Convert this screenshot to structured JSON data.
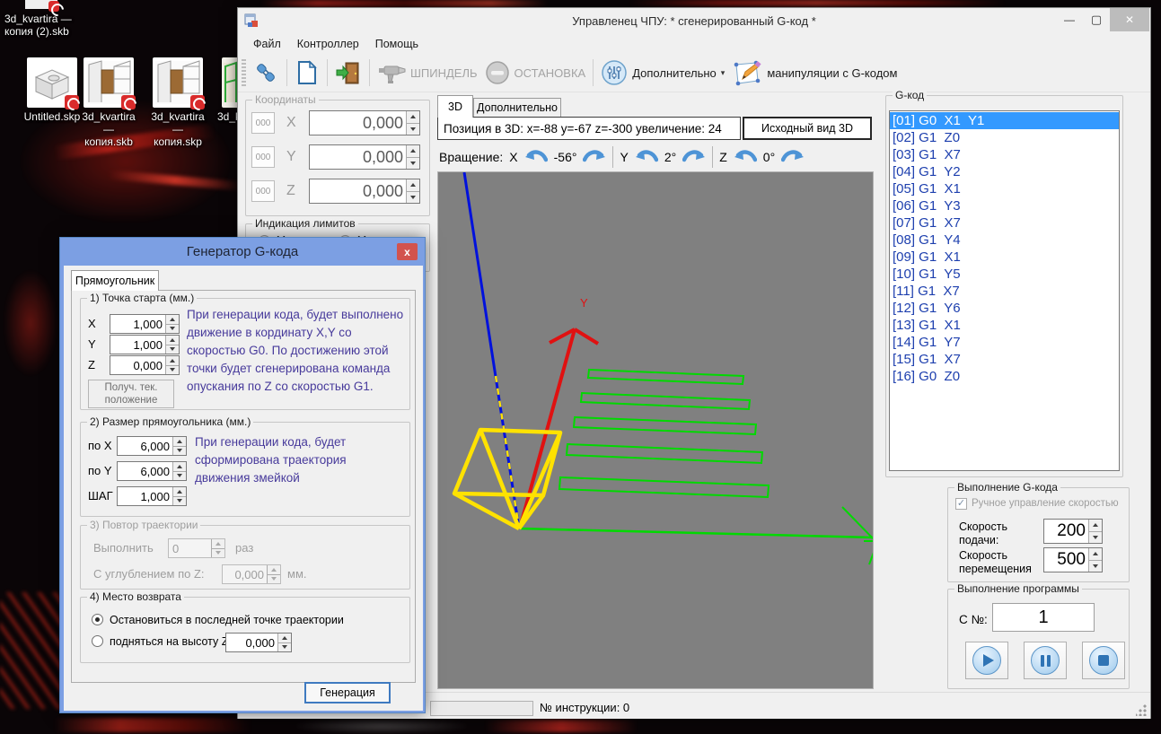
{
  "desktop": {
    "top_file_label": "3d_kvartira — копия (2).skb",
    "icons": [
      {
        "label": "Untitled.skp"
      },
      {
        "label": "3d_kvartira — копия.skb"
      },
      {
        "label": "3d_kvartira — копия.skp"
      },
      {
        "label": "3d_k"
      }
    ]
  },
  "window": {
    "title": "Управленец ЧПУ: * сгенерированный G-код *",
    "menu": {
      "file": "Файл",
      "controller": "Контроллер",
      "help": "Помощь"
    },
    "toolbar": {
      "spindle_label": "ШПИНДЕЛЬ",
      "stop_label": "ОСТАНОВКА",
      "extra_label": "Дополнительно",
      "manip_label": "манипуляции с G-кодом"
    }
  },
  "coords": {
    "title": "Координаты",
    "zero_btn": "000",
    "axis_x": "X",
    "axis_y": "Y",
    "axis_z": "Z",
    "x_value": "0,000",
    "y_value": "0,000",
    "z_value": "0,000"
  },
  "limits": {
    "title": "Индикация лимитов",
    "xmin_label": "Хмин",
    "xmax_label": "Хмакс"
  },
  "view3d": {
    "tab_3d": "3D",
    "tab_extra": "Дополнительно",
    "position_text": "Позиция в 3D: x=-88 y=-67 z=-300 увеличение: 24",
    "reset_button": "Исходный вид 3D",
    "rotation_label": "Вращение:",
    "rot": [
      {
        "axis": "X",
        "value": "-56°"
      },
      {
        "axis": "Y",
        "value": "2°"
      },
      {
        "axis": "Z",
        "value": "0°"
      }
    ],
    "axis_y_label": "Y"
  },
  "gcode": {
    "title": "G-код",
    "items": [
      "[01] G0  X1  Y1",
      "[02] G1  Z0",
      "[03] G1  X7",
      "[04] G1  Y2",
      "[05] G1  X1",
      "[06] G1  Y3",
      "[07] G1  X7",
      "[08] G1  Y4",
      "[09] G1  X1",
      "[10] G1  Y5",
      "[11] G1  X7",
      "[12] G1  Y6",
      "[13] G1  X1",
      "[14] G1  Y7",
      "[15] G1  X7",
      "[16] G0  Z0"
    ]
  },
  "exec": {
    "title": "Выполнение G-кода",
    "manual_label": "Ручное управление скоростью",
    "feed_label": "Скорость подачи:",
    "feed_value": "200",
    "move_label": "Скорость перемещения",
    "move_value": "500"
  },
  "program": {
    "title": "Выполнение программы",
    "from_label": "С №:",
    "from_value": "1"
  },
  "status": {
    "instruction_label": "№ инструкции: 0"
  },
  "dialog": {
    "title": "Генератор G-кода",
    "tab": "Прямоугольник",
    "group1": {
      "title": "1) Точка старта (мм.)",
      "x_label": "X",
      "y_label": "Y",
      "z_label": "Z",
      "x_value": "1,000",
      "y_value": "1,000",
      "z_value": "0,000",
      "get_pos_button": "Получ. тек. положение",
      "help": "При генерации кода, будет выполнено движение в кординату X,Y со скоростью G0. По достижению этой точки будет сгенерирована команда опускания по Z со скоростью G1."
    },
    "group2": {
      "title": "2) Размер прямоугольника (мм.)",
      "x_label": "по X",
      "y_label": "по Y",
      "step_label": "ШАГ",
      "x_value": "6,000",
      "y_value": "6,000",
      "step_value": "1,000",
      "help": "При генерации кода, будет сформирована траектория движения змейкой"
    },
    "group3": {
      "title": "3) Повтор траектории",
      "run_label": "Выполнить",
      "run_value": "0",
      "times_label": "раз",
      "depth_label": "С углублением по Z:",
      "depth_value": "0,000",
      "mm_label": "мм."
    },
    "group4": {
      "title": "4) Место возврата",
      "option_stop": "Остановиться в последней точке траектории",
      "option_raise": "подняться на высоту Z:",
      "raise_value": "0,000"
    },
    "generate_button": "Генерация"
  },
  "colors": {
    "dialog_titlebar": "#7c9fe3",
    "selection_blue": "#3399ff",
    "gcode_text": "#1d3fae",
    "help_text": "#473a9b",
    "viewport_gray": "#808080",
    "path_green": "#00d900",
    "axis_red": "#e01111",
    "spindle_line_blue": "#0011dd",
    "tool_yellow": "#ffe200",
    "close_button_red": "#d2534e"
  },
  "icons": {
    "app-icon": "form-squares",
    "connect-icon": "plug",
    "new-file-icon": "page",
    "exit-icon": "door-green-arrow",
    "spindle-icon": "drill",
    "stop-toolbar-icon": "gray-circle-minus",
    "extra-icon": "blue-circle-sliders",
    "manip-icon": "pencil-on-page",
    "rotate-ccw-icon": "curved-arrow-left",
    "rotate-cw-icon": "curved-arrow-right",
    "play-icon": "triangle",
    "pause-icon": "two-bars",
    "stop-exec-icon": "square",
    "minimize-icon": "–",
    "maximize-icon": "□",
    "close-icon": "✕",
    "sketchup-badge-icon": "red-swirl"
  }
}
